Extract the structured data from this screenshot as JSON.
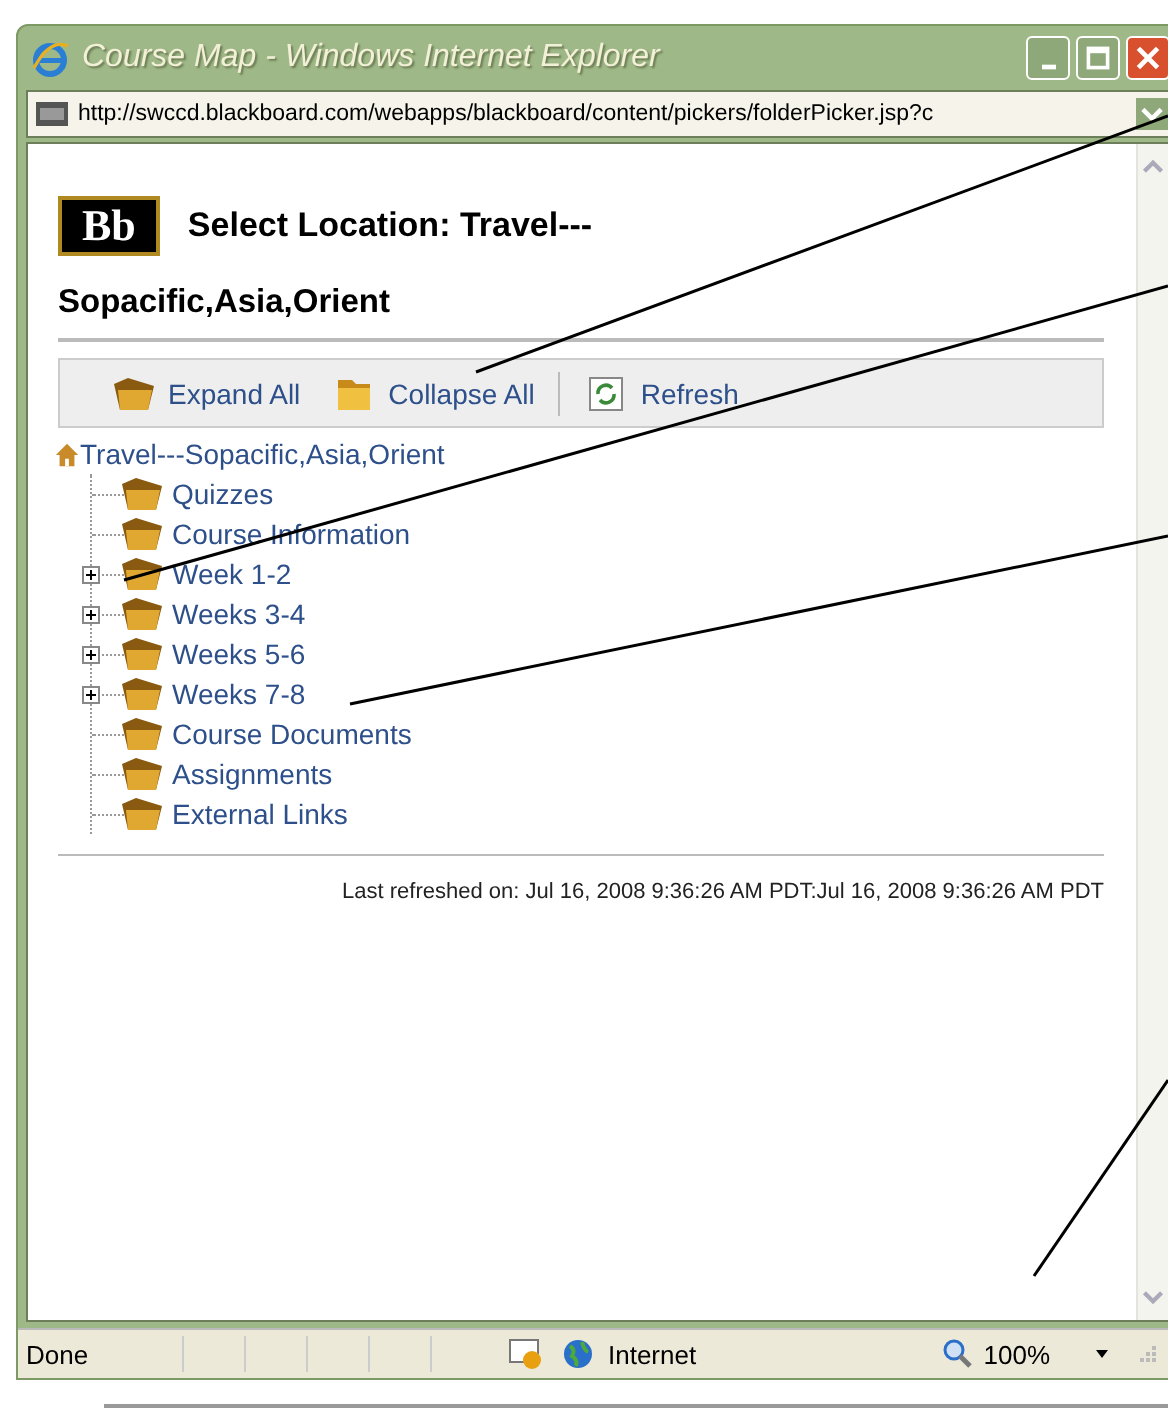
{
  "window": {
    "title": "Course Map - Windows Internet Explorer"
  },
  "address_bar": {
    "url": "http://swccd.blackboard.com/webapps/blackboard/content/pickers/folderPicker.jsp?c"
  },
  "page": {
    "logo": "Bb",
    "heading": "Select Location: Travel---",
    "subheading": "Sopacific,Asia,Orient",
    "toolbar": [
      {
        "label": "Expand All",
        "kind": "expand"
      },
      {
        "label": "Collapse All",
        "kind": "collapse"
      },
      {
        "label": "Refresh",
        "kind": "refresh"
      }
    ],
    "tree": {
      "label": "Travel---Sopacific,Asia,Orient",
      "children": [
        {
          "label": "Quizzes",
          "expandable": false
        },
        {
          "label": "Course Information",
          "expandable": false
        },
        {
          "label": "Week 1-2",
          "expandable": true
        },
        {
          "label": "Weeks 3-4",
          "expandable": true
        },
        {
          "label": "Weeks 5-6",
          "expandable": true
        },
        {
          "label": "Weeks 7-8",
          "expandable": true
        },
        {
          "label": "Course Documents",
          "expandable": false
        },
        {
          "label": "Assignments",
          "expandable": false
        },
        {
          "label": "External Links",
          "expandable": false
        }
      ]
    },
    "last_refreshed": "Last refreshed on: Jul 16, 2008 9:36:26 AM PDT:Jul 16, 2008 9:36:26 AM PDT"
  },
  "status_bar": {
    "status": "Done",
    "zone": "Internet",
    "zoom": "100%"
  }
}
